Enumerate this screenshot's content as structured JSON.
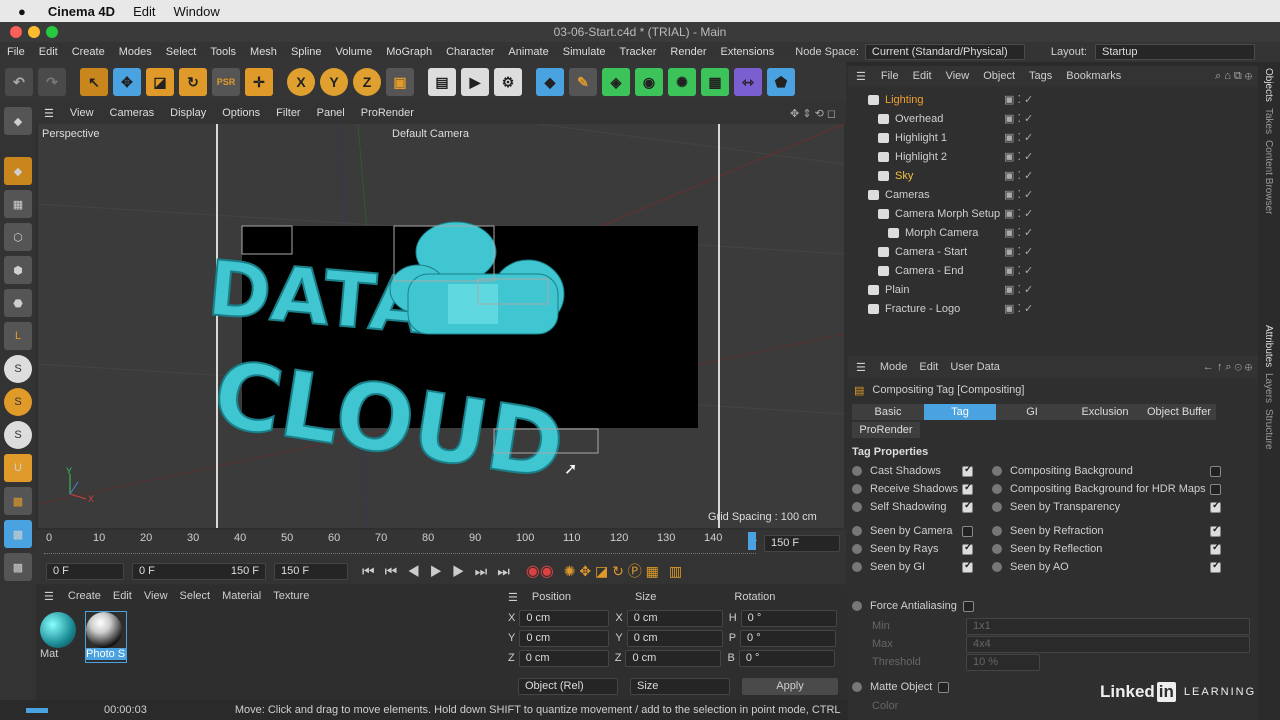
{
  "mac": {
    "app": "Cinema 4D",
    "edit": "Edit",
    "window": "Window"
  },
  "window_title": "03-06-Start.c4d * (TRIAL) - Main",
  "menu": [
    "File",
    "Edit",
    "Create",
    "Modes",
    "Select",
    "Tools",
    "Mesh",
    "Spline",
    "Volume",
    "MoGraph",
    "Character",
    "Animate",
    "Simulate",
    "Tracker",
    "Render",
    "Extensions"
  ],
  "nodespace": {
    "label": "Node Space:",
    "value": "Current (Standard/Physical)"
  },
  "layout": {
    "label": "Layout:",
    "value": "Startup"
  },
  "viewport_menu": [
    "View",
    "Cameras",
    "Display",
    "Options",
    "Filter",
    "Panel",
    "ProRender"
  ],
  "viewport": {
    "label": "Perspective",
    "camera": "Default Camera",
    "grid": "Grid Spacing : 100 cm",
    "logo_top": "DATA",
    "logo_bottom": "CLOUD"
  },
  "timeline": {
    "ticks": [
      "0",
      "10",
      "20",
      "30",
      "40",
      "50",
      "60",
      "70",
      "80",
      "90",
      "100",
      "110",
      "120",
      "130",
      "140",
      "1"
    ],
    "end": "150 F"
  },
  "playback": {
    "start": "0 F",
    "cur": "0 F",
    "end_a": "150 F",
    "end_b": "150 F"
  },
  "materials": {
    "menu": [
      "Create",
      "Edit",
      "View",
      "Select",
      "Material",
      "Texture"
    ],
    "items": [
      "Mat",
      "Photo S"
    ]
  },
  "coords": {
    "headers": [
      "Position",
      "Size",
      "Rotation"
    ],
    "rows": [
      {
        "a": "X",
        "p": "0 cm",
        "b": "X",
        "s": "0 cm",
        "c": "H",
        "r": "0 °"
      },
      {
        "a": "Y",
        "p": "0 cm",
        "b": "Y",
        "s": "0 cm",
        "c": "P",
        "r": "0 °"
      },
      {
        "a": "Z",
        "p": "0 cm",
        "b": "Z",
        "s": "0 cm",
        "c": "B",
        "r": "0 °"
      }
    ],
    "mode1": "Object (Rel)",
    "mode2": "Size",
    "apply": "Apply"
  },
  "objects": {
    "menu": [
      "File",
      "Edit",
      "View",
      "Object",
      "Tags",
      "Bookmarks"
    ],
    "items": [
      {
        "name": "Lighting",
        "indent": 0
      },
      {
        "name": "Overhead",
        "indent": 1
      },
      {
        "name": "Highlight 1",
        "indent": 1
      },
      {
        "name": "Highlight 2",
        "indent": 1
      },
      {
        "name": "Sky",
        "indent": 1
      },
      {
        "name": "Cameras",
        "indent": 0
      },
      {
        "name": "Camera Morph Setup",
        "indent": 1
      },
      {
        "name": "Morph Camera",
        "indent": 2
      },
      {
        "name": "Camera - Start",
        "indent": 1
      },
      {
        "name": "Camera - End",
        "indent": 1
      },
      {
        "name": "Plain",
        "indent": 0
      },
      {
        "name": "Fracture - Logo",
        "indent": 0
      }
    ]
  },
  "attributes": {
    "menu": [
      "Mode",
      "Edit",
      "User Data"
    ],
    "title": "Compositing Tag [Compositing]",
    "tabs": [
      "Basic",
      "Tag",
      "GI",
      "Exclusion",
      "Object Buffer"
    ],
    "tab2": "ProRender",
    "section": "Tag Properties",
    "left": [
      {
        "l": "Cast Shadows",
        "on": true
      },
      {
        "l": "Receive Shadows",
        "on": true
      },
      {
        "l": "Self Shadowing",
        "on": true
      },
      {
        "l": "Seen by Camera",
        "on": false
      },
      {
        "l": "Seen by Rays",
        "on": true
      },
      {
        "l": "Seen by GI",
        "on": true
      }
    ],
    "right": [
      {
        "l": "Compositing Background",
        "on": false
      },
      {
        "l": "Compositing Background for HDR Maps",
        "on": false
      },
      {
        "l": "Seen by Transparency",
        "on": true
      },
      {
        "l": "Seen by Refraction",
        "on": true
      },
      {
        "l": "Seen by Reflection",
        "on": true
      },
      {
        "l": "Seen by AO",
        "on": true
      }
    ],
    "aa": "Force Antialiasing",
    "min": "Min",
    "minv": "1x1",
    "max": "Max",
    "maxv": "4x4",
    "thr": "Threshold",
    "thrv": "10 %",
    "matte": "Matte Object",
    "color": "Color"
  },
  "side_tabs": [
    "Objects",
    "Takes",
    "Content Browser",
    "Attributes",
    "Layers",
    "Structure"
  ],
  "status": {
    "time": "00:00:03",
    "msg": "Move: Click and drag to move elements. Hold down SHIFT to quantize movement / add to the selection in point mode, CTRL"
  },
  "watermark": {
    "brand": "Linked",
    "brand2": "in",
    "learning": "LEARNING"
  },
  "colors": {
    "accent": "#4aa3e0",
    "cyan": "#3fc6d0",
    "orange": "#f0a030"
  }
}
